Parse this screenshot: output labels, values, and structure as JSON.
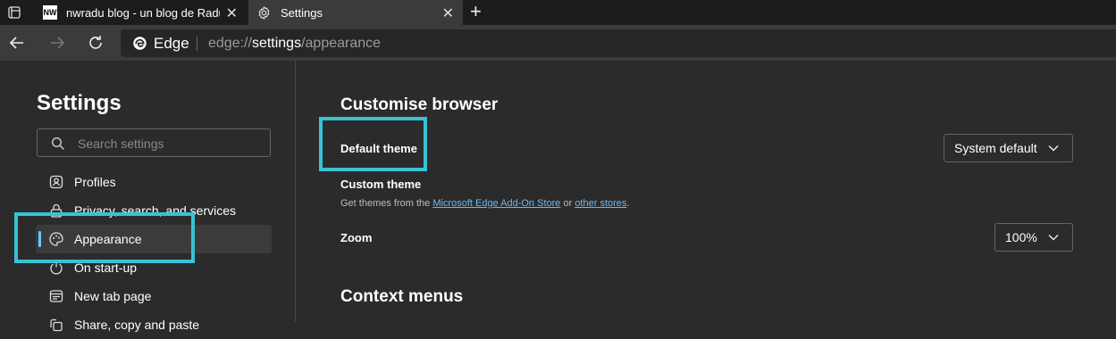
{
  "tabs": [
    {
      "label": "nwradu blog - un blog de Radu Z",
      "favicon": "nw-favicon-icon",
      "close": "✕"
    },
    {
      "label": "Settings",
      "favicon": "gear-icon",
      "close": "✕"
    }
  ],
  "new_tab_symbol": "+",
  "address": {
    "brand": "Edge",
    "url_prefix": "edge://",
    "url_main": "settings",
    "url_suffix": "/appearance"
  },
  "sidebar": {
    "title": "Settings",
    "search_placeholder": "Search settings",
    "items": [
      {
        "label": "Profiles",
        "icon": "profile-icon"
      },
      {
        "label": "Privacy, search, and services",
        "icon": "lock-icon"
      },
      {
        "label": "Appearance",
        "icon": "palette-icon",
        "selected": true
      },
      {
        "label": "On start-up",
        "icon": "power-icon"
      },
      {
        "label": "New tab page",
        "icon": "new-tab-icon"
      },
      {
        "label": "Share, copy and paste",
        "icon": "share-icon"
      }
    ]
  },
  "main": {
    "section_title": "Customise browser",
    "default_theme": {
      "label": "Default theme",
      "value": "System default"
    },
    "custom_theme": {
      "label": "Custom theme",
      "desc_prefix": "Get themes from the ",
      "link1": "Microsoft Edge Add-On Store",
      "desc_mid": " or ",
      "link2": "other stores",
      "desc_suffix": "."
    },
    "zoom": {
      "label": "Zoom",
      "value": "100%"
    },
    "section2_title": "Context menus"
  },
  "colors": {
    "accent": "#60cdff",
    "highlight_box": "#36c3d6",
    "link": "#6cb8f5"
  }
}
